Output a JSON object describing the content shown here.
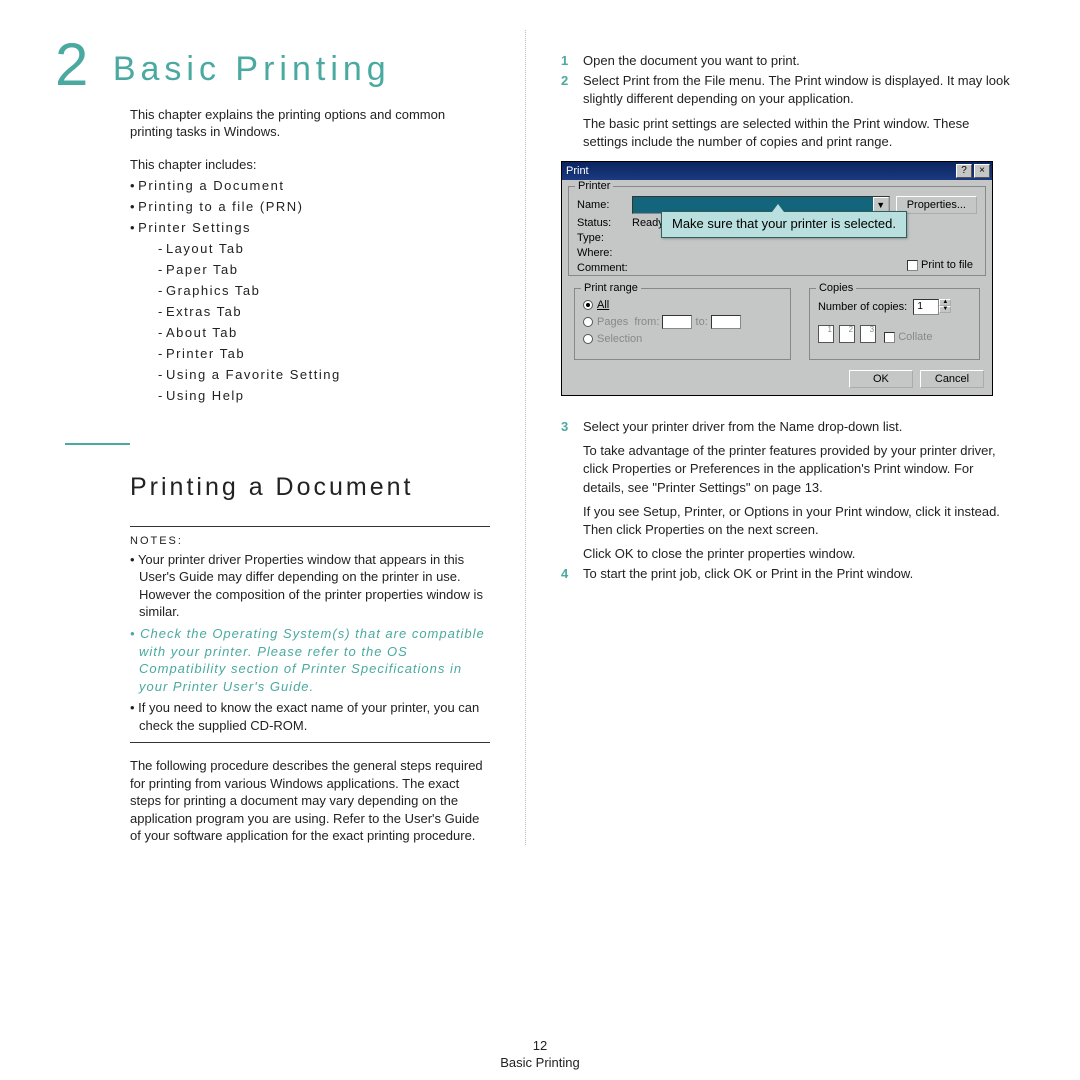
{
  "chapter": {
    "number": "2",
    "title": "Basic Printing"
  },
  "intro": "This chapter explains the printing options and common printing tasks in Windows.",
  "includes_label": "This chapter includes:",
  "toc": [
    "Printing a Document",
    "Printing to a file (PRN)",
    "Printer Settings"
  ],
  "toc_sub": [
    "Layout Tab",
    "Paper Tab",
    "Graphics Tab",
    "Extras Tab",
    "About Tab",
    "Printer Tab",
    "Using a Favorite Setting",
    "Using Help"
  ],
  "section1": "Printing a Document",
  "notes_label": "NOTES:",
  "notes": {
    "n1": "Your printer driver Properties window that appears in this User's Guide may differ depending on the printer in use. However the composition of the printer properties window is similar.",
    "n2": "Check the Operating System(s) that are compatible with your printer. Please refer to the OS Compatibility section of Printer Specifications in your Printer User's Guide.",
    "n3": "If you need to know the exact name of your printer, you can check the supplied CD-ROM."
  },
  "para1": "The following procedure describes the general steps required for printing from various Windows applications. The exact steps for printing a document may vary depending on the application program you are using. Refer to the User's Guide of your software application for the exact printing procedure.",
  "steps": {
    "s1": "Open the document you want to print.",
    "s2a": "Select Print from the File menu. The Print window is displayed. It may look slightly different depending on your application.",
    "s2b": "The basic print settings are selected within the Print window. These settings include the number of copies and print range.",
    "s3a": "Select your printer driver from the Name drop-down list.",
    "s3b": "To take advantage of the printer features provided by your printer driver, click Properties or Preferences in the application's Print window. For details, see \"Printer Settings\" on page 13.",
    "s3c": "If you see Setup, Printer, or Options in your Print window, click it instead. Then click Properties on the next screen.",
    "s3d": "Click OK to close the printer properties window.",
    "s4": "To start the print job, click OK or Print in the Print window."
  },
  "dialog": {
    "title": "Print",
    "help": "?",
    "close": "×",
    "printer_legend": "Printer",
    "name_lbl": "Name:",
    "prop_btn": "Properties...",
    "status_lbl": "Status:",
    "status_val": "Ready",
    "type_lbl": "Type:",
    "where_lbl": "Where:",
    "comment_lbl": "Comment:",
    "ptf_lbl": "Print to file",
    "callout": "Make sure that your printer is selected.",
    "range_legend": "Print range",
    "all_lbl": "All",
    "pages_lbl": "Pages",
    "from_lbl": "from:",
    "to_lbl": "to:",
    "sel_lbl": "Selection",
    "copies_legend": "Copies",
    "numcopies_lbl": "Number of copies:",
    "numcopies_val": "1",
    "collate_lbl": "Collate",
    "ok": "OK",
    "cancel": "Cancel"
  },
  "footer": {
    "page_num": "12",
    "page_label": "Basic Printing"
  }
}
